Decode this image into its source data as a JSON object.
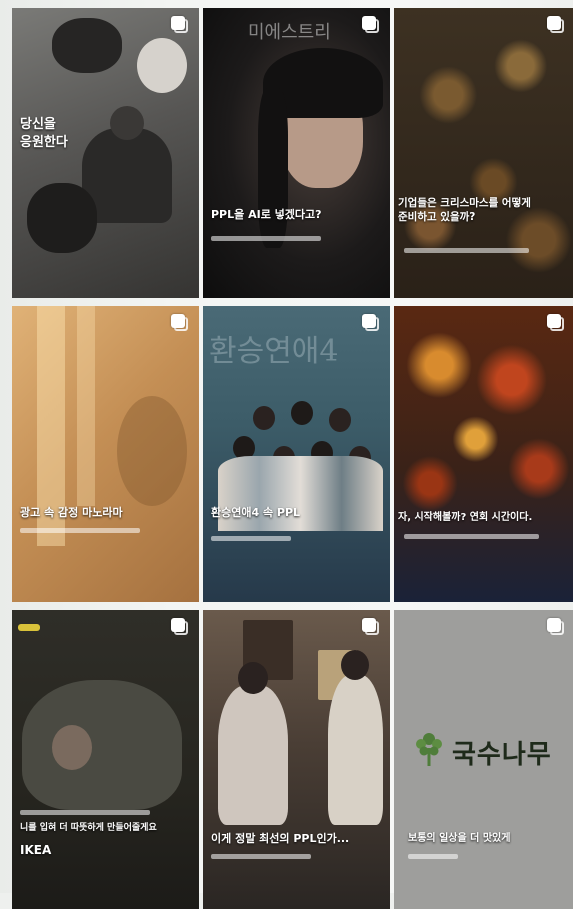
{
  "tiles": [
    {
      "caption": "당신을\n응원한다",
      "colors": {
        "bg_top": "#6a6a68",
        "bg_bottom": "#3a3937"
      }
    },
    {
      "caption": "PPL을 AI로 넣겠다고?",
      "watermark": "미에스트리",
      "colors": {
        "bg_top": "#1e1c1c",
        "bg_bottom": "#0f0f0f"
      }
    },
    {
      "caption": "기업들은 크리스마스를 어떻게\n준비하고 있을까?",
      "colors": {
        "bg_top": "#3d3122",
        "bg_bottom": "#251d14"
      }
    },
    {
      "caption": "광고 속 감정 마노라마",
      "colors": {
        "bg_top": "#b8864f",
        "bg_bottom": "#a06f3e"
      }
    },
    {
      "caption": "환승연애4 속 PPL",
      "watermark": "환승연애4",
      "colors": {
        "bg_top": "#3c5c68",
        "bg_bottom": "#26394a"
      }
    },
    {
      "caption": "자, 시작해볼까? 연회 시간이다.",
      "colors": {
        "bg_top": "#6a2b12",
        "bg_bottom": "#1b1a2a"
      }
    },
    {
      "caption": "IKEA",
      "caption_line1": "니를 입혀 더 따뜻하게 만들어줄게요",
      "brand_tag": "IKEA",
      "colors": {
        "bg_top": "#2f2e28",
        "bg_bottom": "#1c1b18"
      }
    },
    {
      "caption": "이게 정말 최선의 PPL인가...",
      "colors": {
        "bg_top": "#5a4b40",
        "bg_bottom": "#2a2623"
      }
    },
    {
      "brand": "국수나무",
      "caption": "보통의 일상을 더 맛있게",
      "colors": {
        "bg": "#9e9e9c",
        "brand_green": "#4f7d3a"
      }
    }
  ],
  "icons": {
    "multi_post": "copy-icon"
  }
}
